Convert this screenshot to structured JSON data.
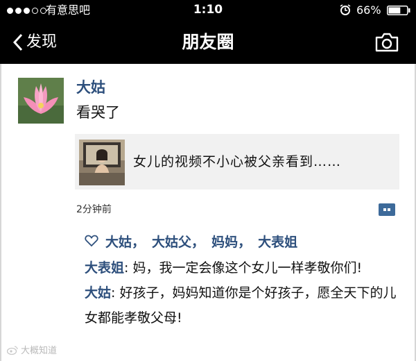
{
  "status_bar": {
    "signal_full": 3,
    "signal_total": 5,
    "carrier": "有意思吧",
    "time": "1:10",
    "battery": "66%",
    "battery_level": 0.66
  },
  "nav": {
    "back_label": "发现",
    "title": "朋友圈"
  },
  "post": {
    "author": "大姑",
    "text": "看哭了",
    "share_title": "女儿的视频不小心被父亲看到……",
    "time": "2分钟前"
  },
  "likes": {
    "names": [
      "大姑",
      "大姑父",
      "妈妈",
      "大表姐"
    ],
    "sep": "，"
  },
  "comments": [
    {
      "author": "大表姐",
      "colon": ":",
      "text": " 妈，我一定会像这个女儿一样孝敬你们!"
    },
    {
      "author": "大姑",
      "colon": ":",
      "text": " 好孩子，妈妈知道你是个好孩子，愿全天下的儿女都能孝敬父母!"
    }
  ],
  "watermark": "大概知道",
  "colors": {
    "bar_bg": "#000000",
    "name_blue": "#2d4f7c",
    "card_bg": "#f1f1f1",
    "comment_icon": "#3d6a9a"
  }
}
